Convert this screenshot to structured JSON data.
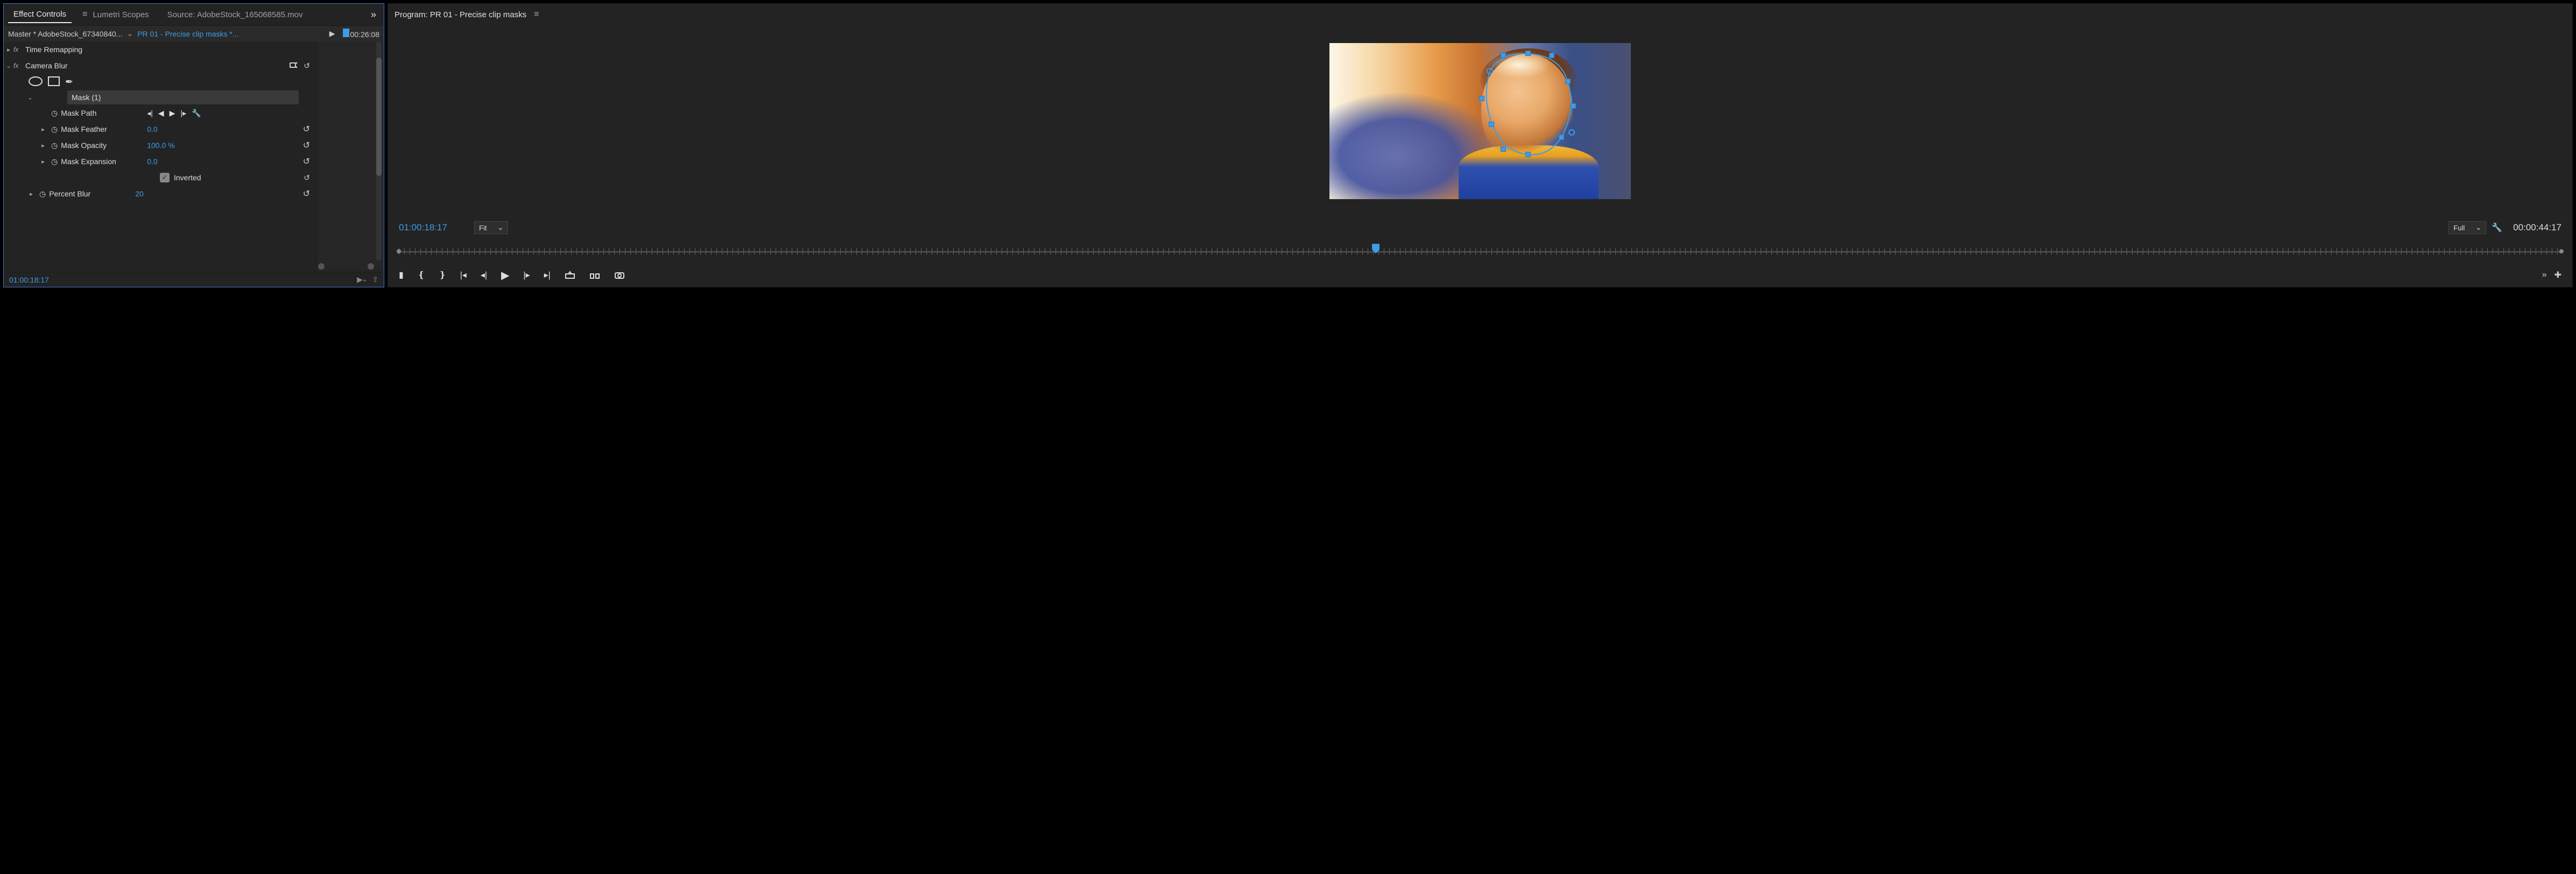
{
  "left": {
    "tabs": {
      "effect_controls": "Effect Controls",
      "lumetri_scopes": "Lumetri Scopes",
      "source": "Source: AdobeStock_165068585.mov"
    },
    "master": {
      "clip": "Master * AdobeStock_67340840...",
      "timeline": "PR 01 - Precise clip masks *...",
      "timecode": "00:26:08"
    },
    "effects": {
      "time_remapping": "Time Remapping",
      "camera_blur": "Camera Blur",
      "mask_label": "Mask (1)",
      "params": {
        "mask_path": "Mask Path",
        "mask_feather": {
          "label": "Mask Feather",
          "value": "0.0"
        },
        "mask_opacity": {
          "label": "Mask Opacity",
          "value": "100.0 %"
        },
        "mask_expansion": {
          "label": "Mask Expansion",
          "value": "0.0"
        },
        "inverted": "Inverted",
        "percent_blur": {
          "label": "Percent Blur",
          "value": "20"
        }
      }
    },
    "footer_tc": "01:00:18:17"
  },
  "right": {
    "title": "Program: PR 01 - Precise clip masks",
    "current_tc": "01:00:18:17",
    "fit": "Fit",
    "quality": "Full",
    "duration_tc": "00:00:44:17"
  }
}
